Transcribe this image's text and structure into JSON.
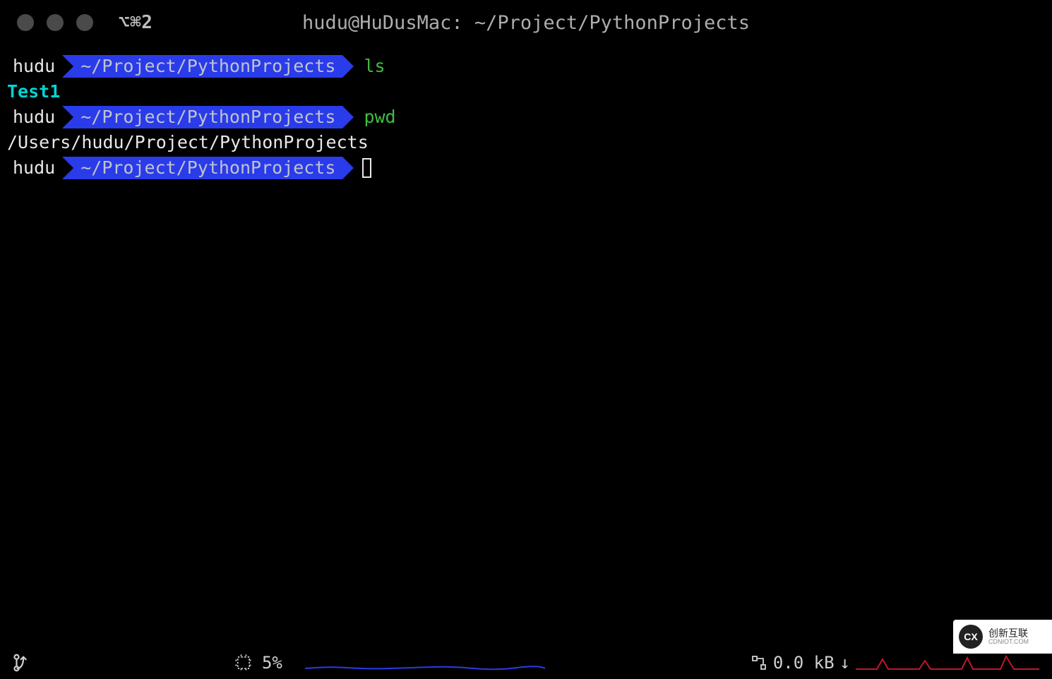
{
  "titlebar": {
    "tab_label": "⌥⌘2",
    "window_title": "hudu@HuDusMac: ~/Project/PythonProjects"
  },
  "prompt": {
    "user": "hudu",
    "path": "~/Project/PythonProjects"
  },
  "lines": [
    {
      "command": "ls"
    },
    {
      "output_cyan": "Test1"
    },
    {
      "command": "pwd"
    },
    {
      "output_plain": "/Users/hudu/Project/PythonProjects"
    },
    {
      "cursor": true
    }
  ],
  "statusbar": {
    "git_icon": "git-branch-icon",
    "cpu_label": "5%",
    "net_label": "0.0 kB",
    "net_arrow": "↓"
  },
  "watermark": {
    "logo": "CX",
    "line1": "创新互联",
    "line2": "CDNIOT.COM"
  }
}
